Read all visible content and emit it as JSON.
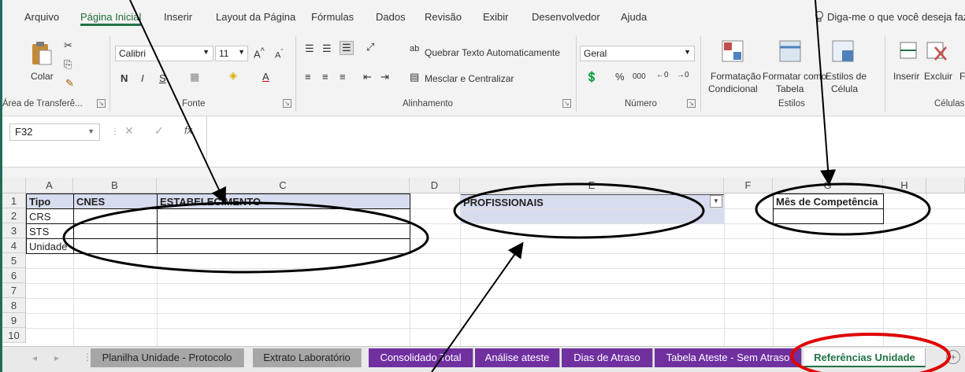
{
  "ribbon": {
    "tabs": [
      "Arquivo",
      "Página Inicial",
      "Inserir",
      "Layout da Página",
      "Fórmulas",
      "Dados",
      "Revisão",
      "Exibir",
      "Desenvolvedor",
      "Ajuda"
    ],
    "tell_me": "Diga-me o que você deseja fazer",
    "clipboard": {
      "paste": "Colar",
      "group": "Área de Transferê..."
    },
    "font": {
      "name": "Calibri",
      "size": "11",
      "bold": "N",
      "italic": "I",
      "underline": "S",
      "group": "Fonte"
    },
    "alignment": {
      "wrap": "Quebrar Texto Automaticamente",
      "merge": "Mesclar e Centralizar",
      "group": "Alinhamento"
    },
    "number": {
      "format": "Geral",
      "percent": "%",
      "thousands": "000",
      "group": "Número"
    },
    "styles": {
      "conditional_1": "Formatação",
      "conditional_2": "Condicional",
      "table_1": "Formatar como",
      "table_2": "Tabela",
      "cell_1": "Estilos de",
      "cell_2": "Célula",
      "group": "Estilos"
    },
    "cells": {
      "insert": "Inserir",
      "delete": "Excluir",
      "format": "F",
      "group": "Células"
    }
  },
  "formula_bar": {
    "name_box": "F32",
    "fx": "fx"
  },
  "columns": [
    "A",
    "B",
    "C",
    "D",
    "E",
    "F",
    "G",
    "H"
  ],
  "rows": [
    "1",
    "2",
    "3",
    "4",
    "5",
    "6",
    "7",
    "8",
    "9",
    "10"
  ],
  "cells": {
    "A1": "Tipo",
    "B1": "CNES",
    "C1": "ESTABELECIMENTO",
    "E1": "PROFISSIONAIS",
    "G1": "Mês de Competência",
    "A2": "CRS",
    "A3": "STS",
    "A4": "Unidade"
  },
  "sheet_tabs": [
    {
      "label": "Planilha Unidade - Protocolo",
      "style": "gray"
    },
    {
      "label": "Extrato Laboratório",
      "style": "gray"
    },
    {
      "label": "Consolidado Total",
      "style": "purple"
    },
    {
      "label": "Análise ateste",
      "style": "purple"
    },
    {
      "label": "Dias de Atraso",
      "style": "purple"
    },
    {
      "label": "Tabela Ateste - Sem Atraso",
      "style": "purple"
    },
    {
      "label": "Referências Unidade",
      "style": "active"
    }
  ],
  "colors": {
    "frame": "#1f6b5c",
    "accent": "#217346",
    "purple_tab": "#7030a0",
    "annotation_red": "#e00000"
  }
}
